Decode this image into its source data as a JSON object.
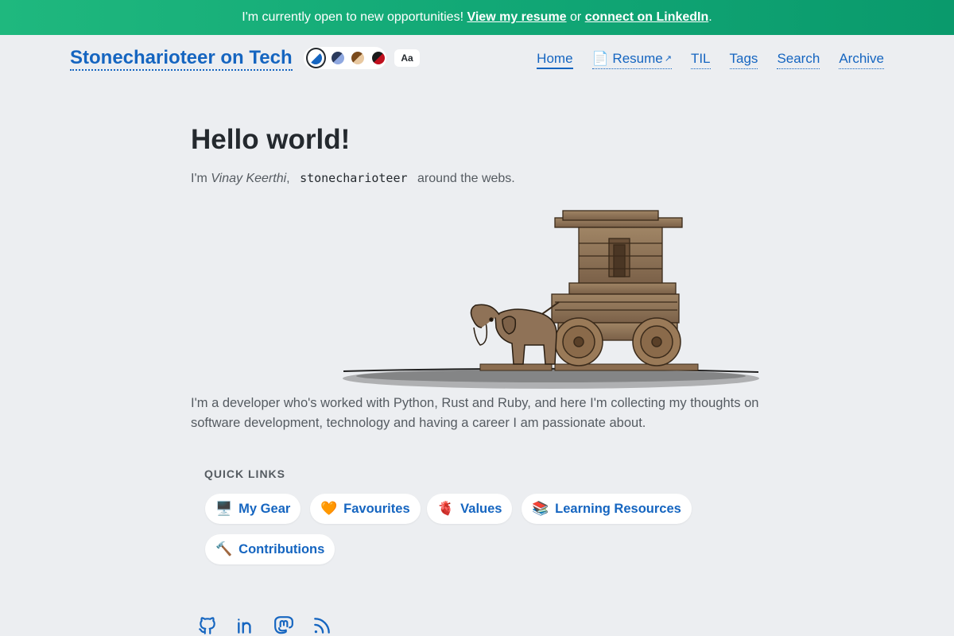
{
  "banner": {
    "text": "I'm currently open to new opportunities! ",
    "resume_link": "View my resume",
    "or_text": " or ",
    "linkedin_link": "connect on LinkedIn",
    "end": "."
  },
  "header": {
    "site_title": "Stonecharioteer on Tech",
    "font_toggle": "Aa",
    "themes": [
      {
        "name": "default",
        "colors": [
          "#1565c0",
          "#ffffff"
        ]
      },
      {
        "name": "dusk",
        "colors": [
          "#2a3a5c",
          "#8fa8e0"
        ]
      },
      {
        "name": "earth",
        "colors": [
          "#7a4a1c",
          "#e8c8a0"
        ]
      },
      {
        "name": "crimson",
        "colors": [
          "#c0101e",
          "#1a1a1a"
        ]
      }
    ]
  },
  "nav": {
    "home": "Home",
    "resume": "📄 Resume",
    "til": "TIL",
    "tags": "Tags",
    "search": "Search",
    "archive": "Archive"
  },
  "main": {
    "heading": "Hello world!",
    "intro_prefix": "I'm ",
    "intro_name": "Vinay Keerthi",
    "intro_comma": ",",
    "intro_handle": "stonecharioteer",
    "intro_suffix": "around the webs.",
    "bio": "I'm a developer who's worked with Python, Rust and Ruby, and here I'm collecting my thoughts on software development, technology and having a career I am passionate about."
  },
  "quick_links": {
    "heading": "QUICK LINKS",
    "items": [
      {
        "emoji": "🖥️",
        "label": "My Gear"
      },
      {
        "emoji": "🧡",
        "label": "Favourites"
      },
      {
        "emoji": "🫀",
        "label": "Values"
      },
      {
        "emoji": "📚",
        "label": "Learning Resources"
      },
      {
        "emoji": "🔨",
        "label": "Contributions"
      }
    ]
  },
  "social": [
    "github-icon",
    "linkedin-icon",
    "mastodon-icon",
    "rss-icon"
  ]
}
